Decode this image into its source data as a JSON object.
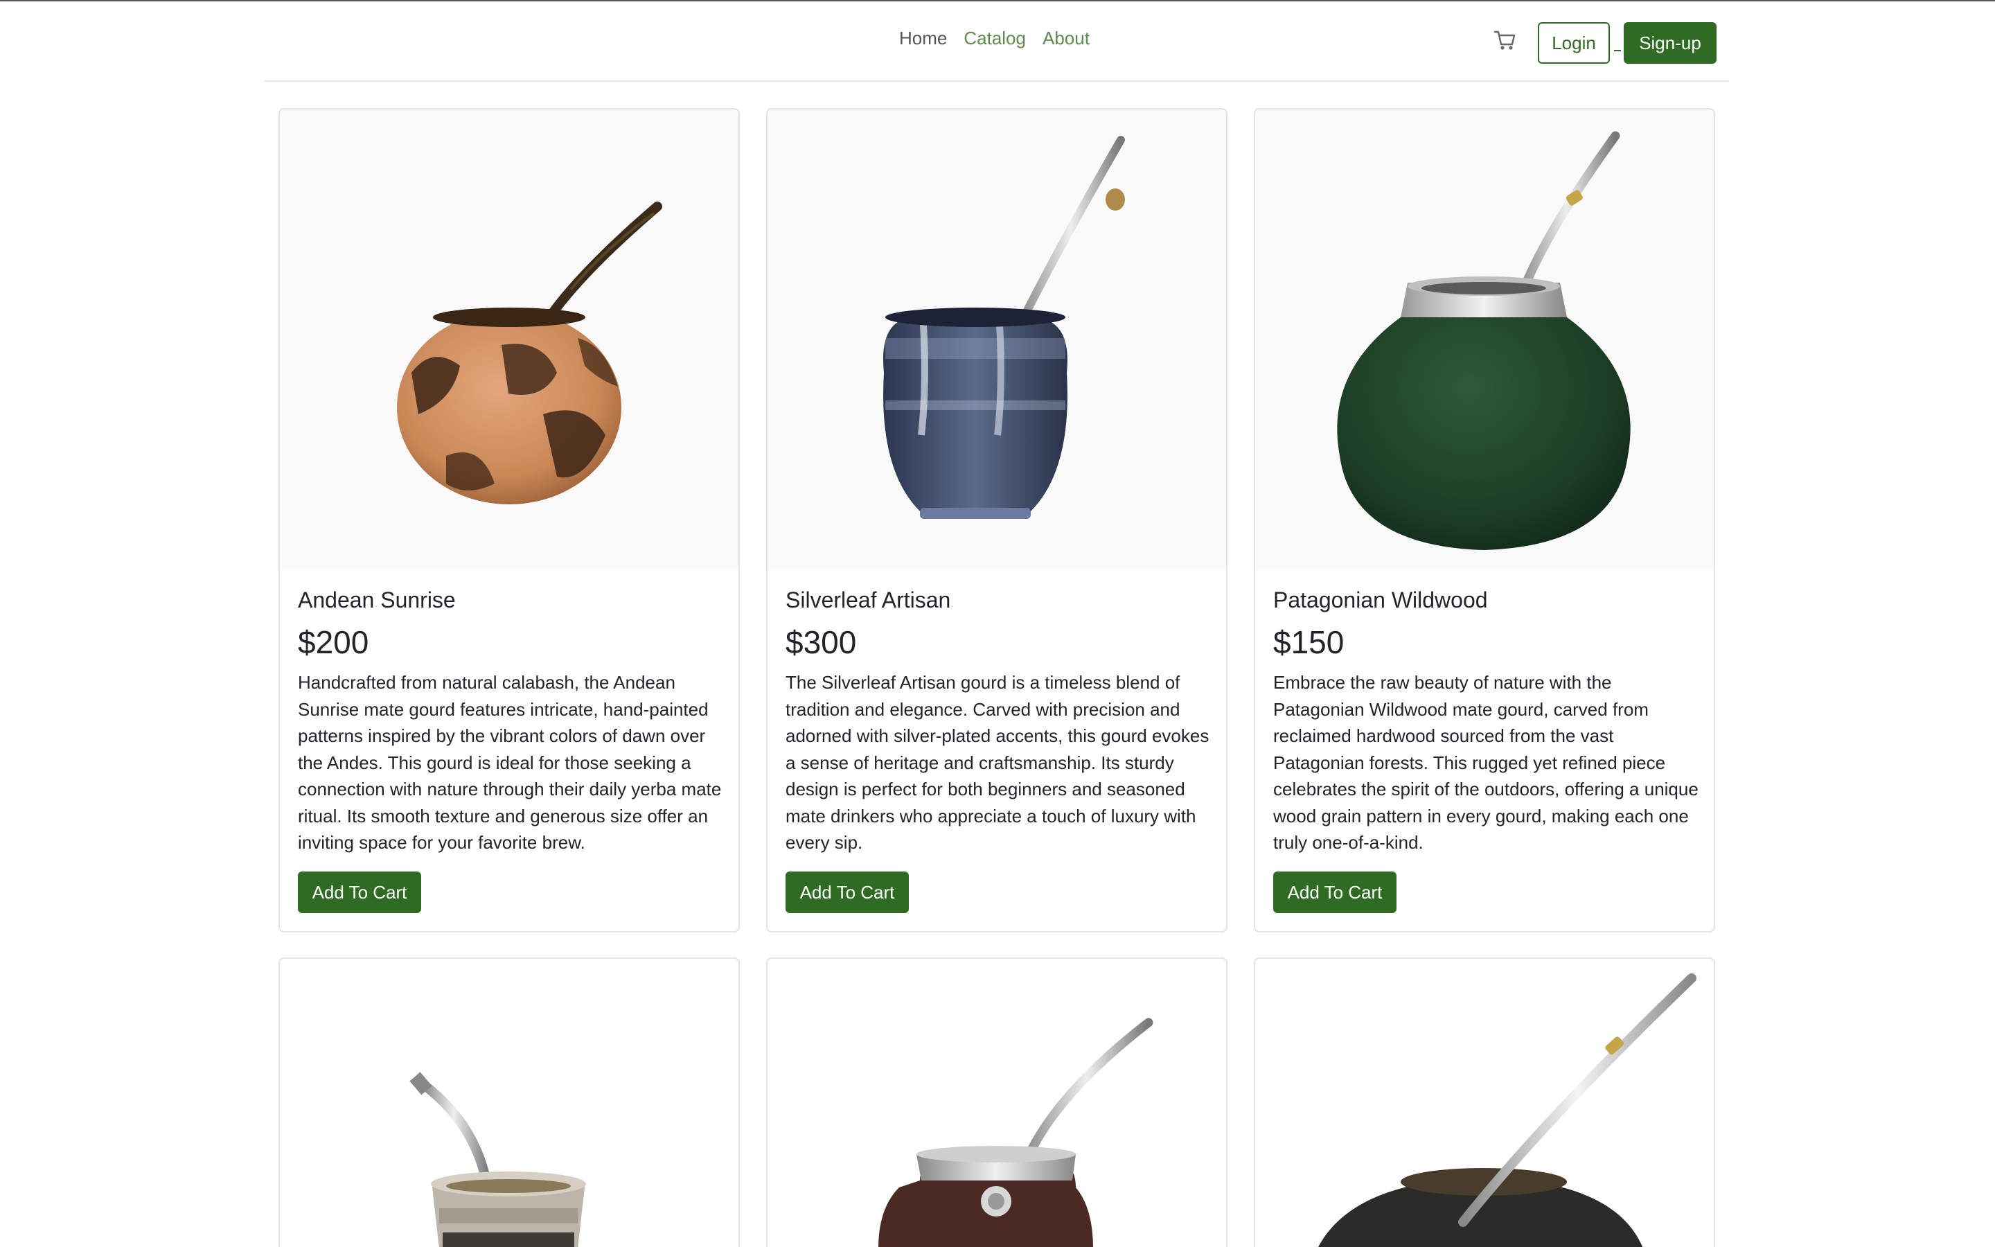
{
  "nav": {
    "home": "Home",
    "catalog": "Catalog",
    "about": "About"
  },
  "header": {
    "cart_icon": "cart-icon",
    "login": "Login",
    "signup": "Sign-up"
  },
  "colors": {
    "brand_green": "#2f6b22",
    "nav_green": "#5c8a4f"
  },
  "products": [
    {
      "name": "Andean Sunrise",
      "price": "$200",
      "description": "Handcrafted from natural calabash, the Andean Sunrise mate gourd features intricate, hand-painted patterns inspired by the vibrant colors of dawn over the Andes. This gourd is ideal for those seeking a connection with nature through their daily yerba mate ritual. Its smooth texture and generous size offer an inviting space for your favorite brew.",
      "button": "Add To Cart"
    },
    {
      "name": "Silverleaf Artisan",
      "price": "$300",
      "description": "The Silverleaf Artisan gourd is a timeless blend of tradition and elegance. Carved with precision and adorned with silver-plated accents, this gourd evokes a sense of heritage and craftsmanship. Its sturdy design is perfect for both beginners and seasoned mate drinkers who appreciate a touch of luxury with every sip.",
      "button": "Add To Cart"
    },
    {
      "name": "Patagonian Wildwood",
      "price": "$150",
      "description": "Embrace the raw beauty of nature with the Patagonian Wildwood mate gourd, carved from reclaimed hardwood sourced from the vast Patagonian forests. This rugged yet refined piece celebrates the spirit of the outdoors, offering a unique wood grain pattern in every gourd, making each one truly one-of-a-kind.",
      "button": "Add To Cart"
    }
  ]
}
